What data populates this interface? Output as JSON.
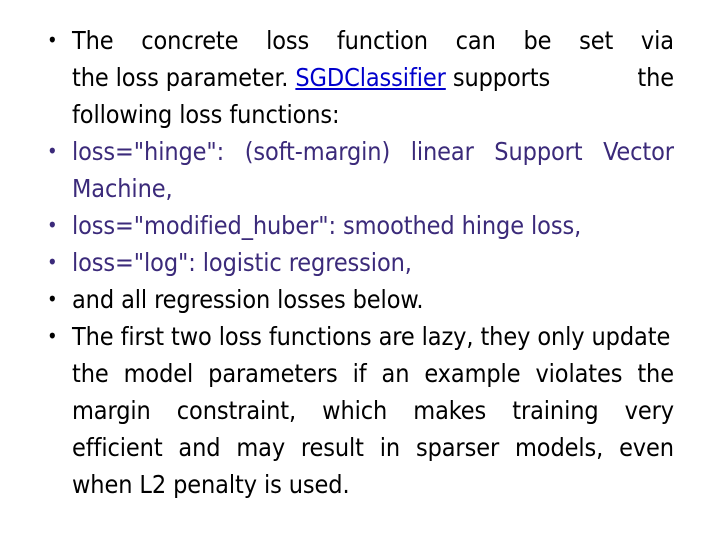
{
  "slide": {
    "background_color": "#FFFFFF",
    "text_colors": {
      "default": "#000000",
      "accent_purple": "#3B2A7A",
      "hyperlink": "#0000CC"
    },
    "bullet_glyph": "•"
  },
  "bullets": [
    {
      "id": "bullet-concrete-loss-function",
      "color": "#000000",
      "marker": "•",
      "lines": [
        {
          "type": "justified",
          "words": [
            "The",
            "concrete",
            "loss",
            "function",
            "can",
            "be",
            "set",
            "via"
          ]
        },
        {
          "type": "link-line",
          "pre": "the loss parameter. ",
          "link": "SGDClassifier",
          "post": " supports",
          "tail": "the"
        },
        {
          "type": "last",
          "text": "following loss functions:"
        }
      ],
      "plain_text": "The concrete loss function can be set via the loss parameter. SGDClassifier supports the following loss functions:"
    },
    {
      "id": "bullet-loss-hinge",
      "color": "#3B2A7A",
      "marker": "•",
      "lines": [
        {
          "type": "justified",
          "words": [
            "loss=\"hinge\":",
            "(soft-margin)",
            "linear",
            "Support",
            "Vector"
          ]
        },
        {
          "type": "last",
          "text": "Machine,"
        }
      ],
      "plain_text": "loss=\"hinge\": (soft-margin) linear Support Vector Machine,"
    },
    {
      "id": "bullet-loss-modified-huber",
      "color": "#3B2A7A",
      "marker": "•",
      "lines": [
        {
          "type": "last",
          "text": "loss=\"modified_huber\": smoothed hinge loss,"
        }
      ],
      "plain_text": "loss=\"modified_huber\": smoothed hinge loss,"
    },
    {
      "id": "bullet-loss-log",
      "color": "#3B2A7A",
      "marker": "•",
      "lines": [
        {
          "type": "last",
          "text": "loss=\"log\": logistic regression,"
        }
      ],
      "plain_text": "loss=\"log\": logistic regression,"
    },
    {
      "id": "bullet-regression-losses",
      "color": "#000000",
      "marker": "•",
      "lines": [
        {
          "type": "last",
          "text": "and all regression losses below."
        }
      ],
      "plain_text": "and all regression losses below."
    },
    {
      "id": "bullet-lazy-loss-functions",
      "color": "#000000",
      "marker": "•",
      "lines": [
        {
          "type": "last",
          "text": "The first two loss functions are lazy, they only update"
        },
        {
          "type": "justified",
          "words": [
            "the",
            "model",
            "parameters",
            "if",
            "an",
            "example",
            "violates",
            "the"
          ]
        },
        {
          "type": "justified",
          "words": [
            "margin",
            "constraint,",
            "which",
            "makes",
            "training",
            "very"
          ]
        },
        {
          "type": "justified",
          "words": [
            "efficient",
            "and",
            "may",
            "result",
            "in",
            "sparser",
            "models,",
            "even"
          ]
        },
        {
          "type": "last",
          "text": "when L2 penalty is used."
        }
      ],
      "plain_text": "The first two loss functions are lazy, they only update the model parameters if an example violates the margin constraint, which makes training very efficient and may result in sparser models, even when L2 penalty is used."
    }
  ]
}
